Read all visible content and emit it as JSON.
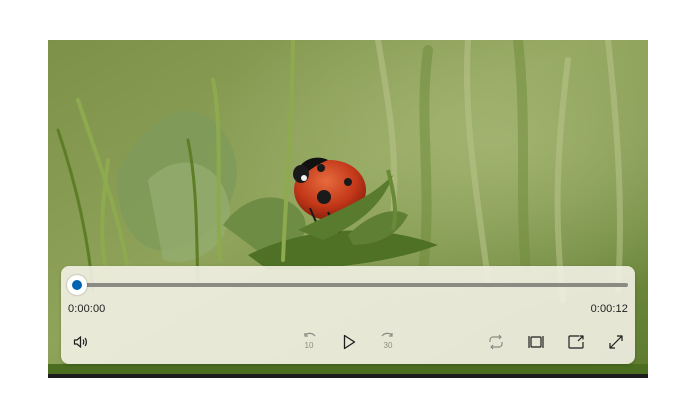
{
  "player": {
    "time_current": "0:00:00",
    "time_total": "0:00:12",
    "progress": 0.0,
    "accent_color": "#0063b1",
    "controls": {
      "volume_icon": "volume-icon",
      "skip_back_label": "10",
      "play_icon": "play-icon",
      "skip_forward_label": "30",
      "repeat_icon": "repeat-icon",
      "aspect_icon": "aspect-ratio-icon",
      "cast_icon": "cast-icon",
      "fullscreen_icon": "fullscreen-icon"
    }
  }
}
